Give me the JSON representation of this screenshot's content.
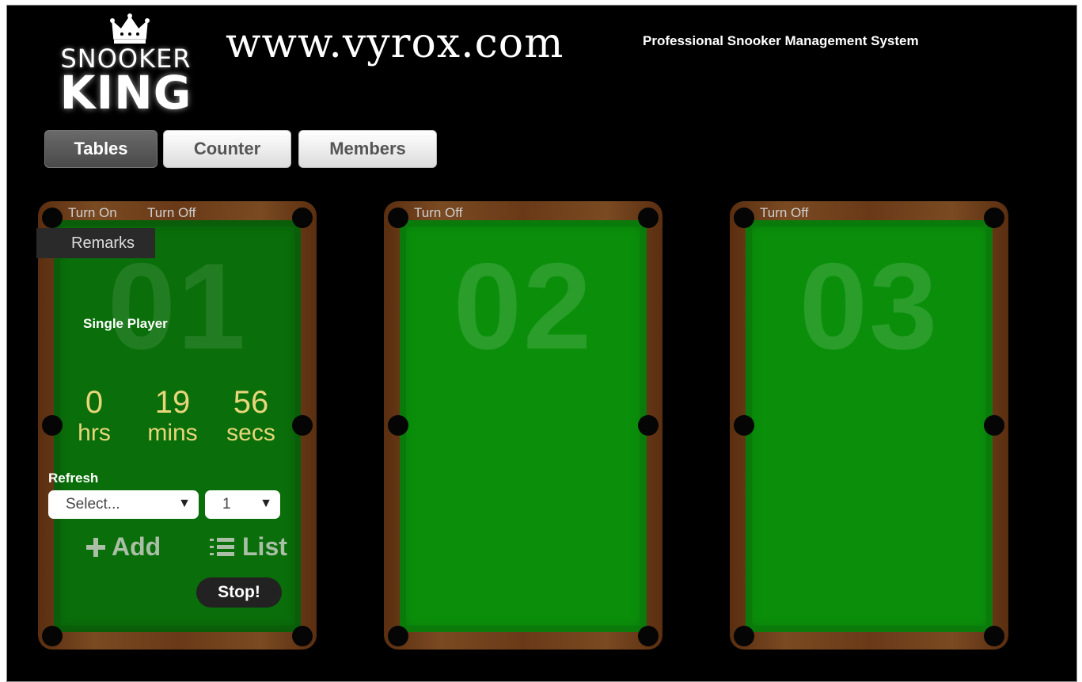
{
  "header": {
    "logo_line1": "SNOOKER",
    "logo_line2": "KING",
    "site_url": "www.vyrox.com",
    "tagline": "Professional Snooker Management System"
  },
  "nav": {
    "tabs": [
      {
        "label": "Tables",
        "active": true
      },
      {
        "label": "Counter",
        "active": false
      },
      {
        "label": "Members",
        "active": false
      }
    ]
  },
  "tables": [
    {
      "number": "01",
      "turn_on_label": "Turn On",
      "turn_off_label": "Turn Off",
      "remarks_label": "Remarks",
      "player_mode": "Single Player",
      "timer": {
        "hours": "0",
        "hours_unit": "hrs",
        "minutes": "19",
        "minutes_unit": "mins",
        "seconds": "56",
        "seconds_unit": "secs"
      },
      "refresh_label": "Refresh",
      "select_value": "Select...",
      "quantity_value": "1",
      "add_label": "Add",
      "list_label": "List",
      "stop_label": "Stop!"
    },
    {
      "number": "02",
      "turn_off_label": "Turn Off"
    },
    {
      "number": "03",
      "turn_off_label": "Turn Off"
    }
  ],
  "colors": {
    "background": "#000000",
    "felt": "#0b8f0b",
    "timer_text": "#e8d67a",
    "active_tab": "#555555"
  }
}
